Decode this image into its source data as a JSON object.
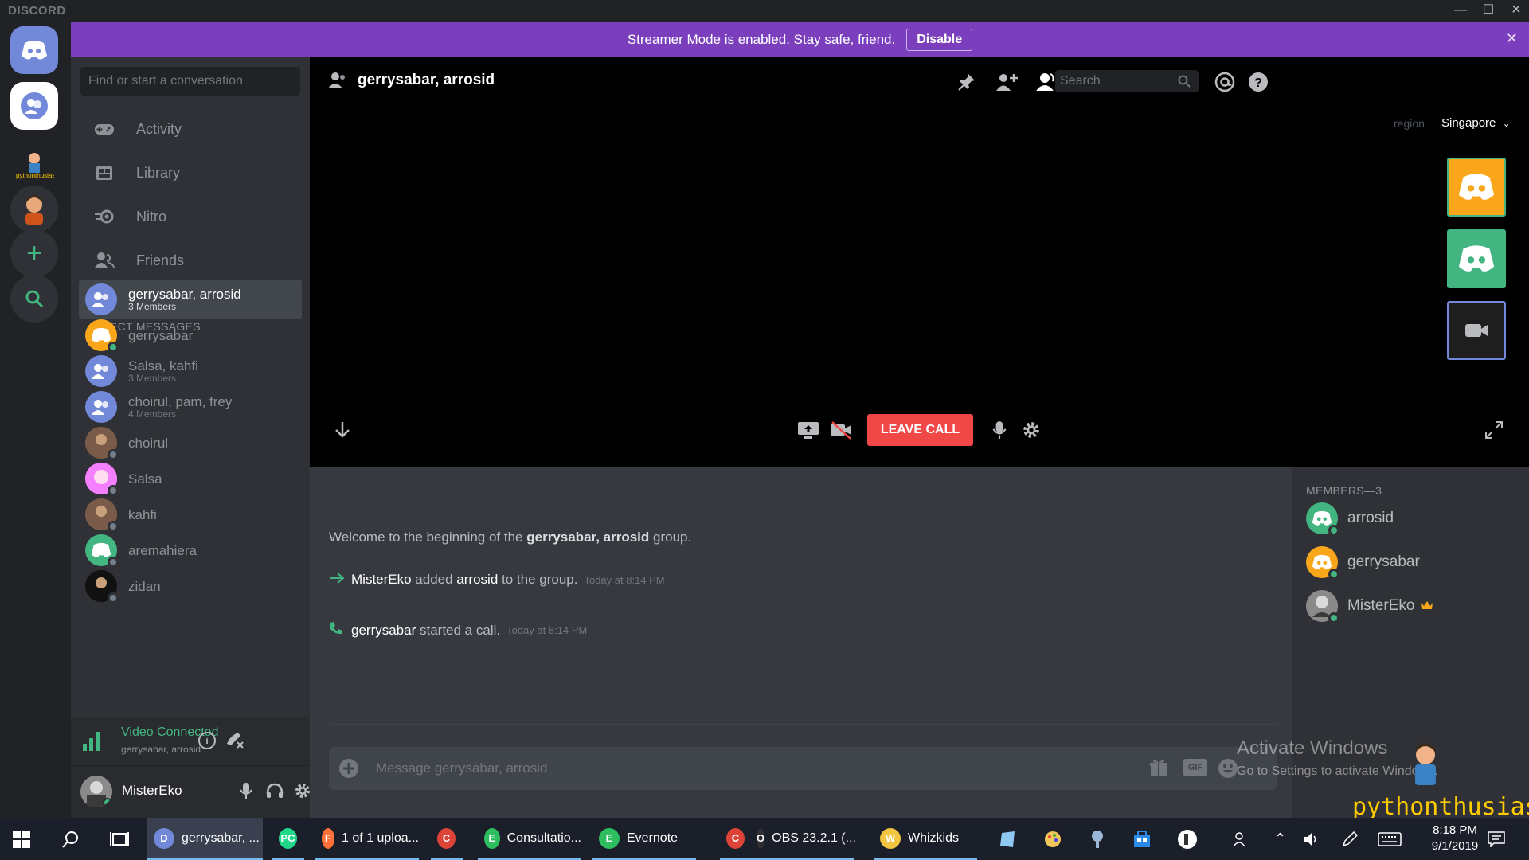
{
  "app": {
    "brand": "DISCORD"
  },
  "banner": {
    "text": "Streamer Mode is enabled. Stay safe, friend.",
    "button": "Disable"
  },
  "sidebar": {
    "search_placeholder": "Find or start a conversation",
    "nav": [
      {
        "label": "Activity",
        "icon": "gamepad-icon"
      },
      {
        "label": "Library",
        "icon": "library-icon"
      },
      {
        "label": "Nitro",
        "icon": "nitro-icon"
      },
      {
        "label": "Friends",
        "icon": "friends-icon"
      }
    ],
    "dm_header": "DIRECT MESSAGES",
    "dms": [
      {
        "name": "gerrysabar, arrosid",
        "sub": "3 Members",
        "avatar": "group",
        "active": true
      },
      {
        "name": "gerrysabar",
        "sub": "",
        "avatar": "orange",
        "status": "online"
      },
      {
        "name": "Salsa, kahfi",
        "sub": "3 Members",
        "avatar": "group"
      },
      {
        "name": "choirul, pam, frey",
        "sub": "4 Members",
        "avatar": "group"
      },
      {
        "name": "choirul",
        "sub": "",
        "avatar": "photo",
        "status": "offline"
      },
      {
        "name": "Salsa",
        "sub": "",
        "avatar": "pink",
        "status": "offline"
      },
      {
        "name": "kahfi",
        "sub": "",
        "avatar": "photo",
        "status": "offline"
      },
      {
        "name": "aremahiera",
        "sub": "",
        "avatar": "green",
        "status": "offline"
      },
      {
        "name": "zidan",
        "sub": "",
        "avatar": "dark",
        "status": "offline"
      }
    ]
  },
  "voice": {
    "status": "Video Connected",
    "channel": "gerrysabar, arrosid"
  },
  "user": {
    "name": "MisterEko"
  },
  "chat": {
    "title": "gerrysabar, arrosid",
    "search_placeholder": "Search",
    "region_label": "region",
    "region_value": "Singapore",
    "leave_call": "LEAVE CALL",
    "welcome_prefix": "Welcome to the beginning of the ",
    "welcome_group": "gerrysabar, arrosid",
    "welcome_suffix": " group.",
    "events": [
      {
        "actor": "MisterEko",
        "verb": " added ",
        "target": "arrosid",
        "rest": " to the group.",
        "time": "Today at 8:14 PM",
        "icon": "arrow-right-icon"
      },
      {
        "actor": "gerrysabar",
        "verb": " started a call.",
        "target": "",
        "rest": "",
        "time": "Today at 8:14 PM",
        "icon": "phone-icon"
      }
    ],
    "message_placeholder": "Message gerrysabar, arrosid"
  },
  "members": {
    "header": "MEMBERS—3",
    "list": [
      {
        "name": "arrosid",
        "avatar": "green"
      },
      {
        "name": "gerrysabar",
        "avatar": "orange"
      },
      {
        "name": "MisterEko",
        "avatar": "photo",
        "owner": true
      }
    ]
  },
  "watermark": {
    "title": "Activate Windows",
    "sub": "Go to Settings to activate Windows.",
    "logo": "pythonthusiast"
  },
  "taskbar": {
    "items": [
      {
        "label": "gerrysabar, ...",
        "color": "#7289da",
        "glyph": "D"
      },
      {
        "label": "",
        "color": "#21d789",
        "glyph": "PC"
      },
      {
        "label": "1 of 1 uploa...",
        "color": "#ff7139",
        "glyph": "F"
      },
      {
        "label": "",
        "color": "#db4437",
        "glyph": "C"
      },
      {
        "label": "Consultatio...",
        "color": "#2dbe60",
        "glyph": "E"
      },
      {
        "label": "Evernote",
        "color": "#2dbe60",
        "glyph": "E"
      },
      {
        "label": "",
        "color": "#db4437",
        "glyph": "C"
      },
      {
        "label": "OBS 23.2.1 (...",
        "color": "#302e31",
        "glyph": "O"
      },
      {
        "label": "Whizkids",
        "color": "#f4c542",
        "glyph": "W"
      }
    ],
    "time": "8:18 PM",
    "date": "9/1/2019"
  }
}
